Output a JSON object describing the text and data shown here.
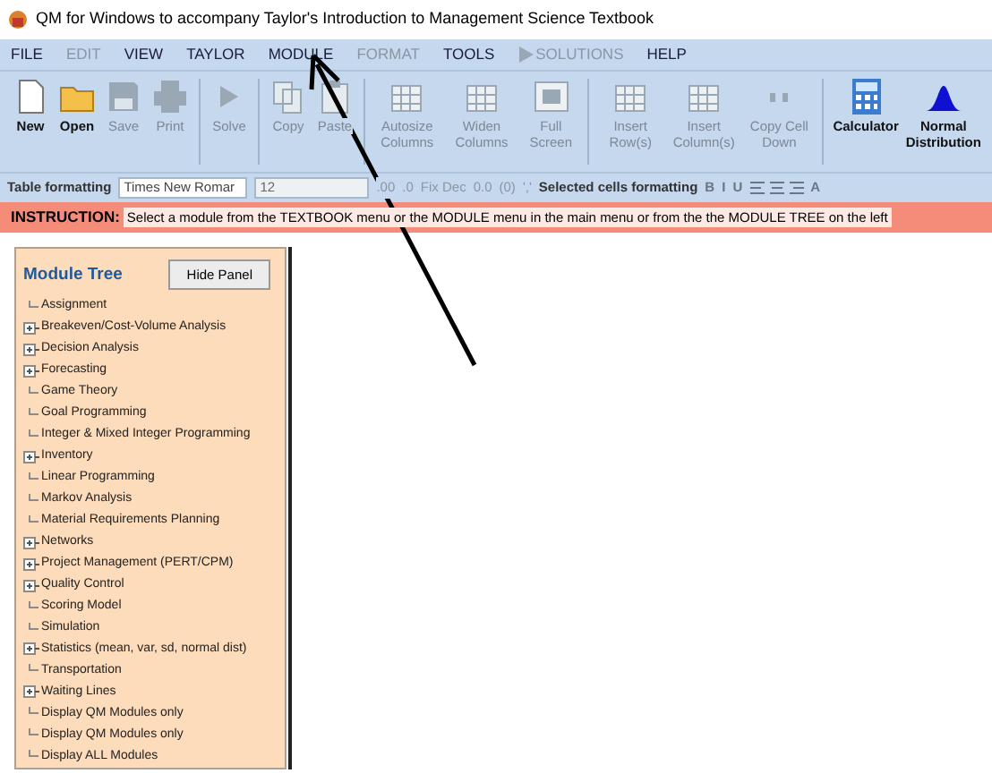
{
  "window": {
    "title": "QM for Windows to accompany Taylor's Introduction to Management Science Textbook"
  },
  "menu": [
    {
      "label": "FILE",
      "disabled": false
    },
    {
      "label": "EDIT",
      "disabled": true
    },
    {
      "label": "VIEW",
      "disabled": false
    },
    {
      "label": "TAYLOR",
      "disabled": false
    },
    {
      "label": "MODULE",
      "disabled": false
    },
    {
      "label": "FORMAT",
      "disabled": true
    },
    {
      "label": "TOOLS",
      "disabled": false
    },
    {
      "label": "SOLUTIONS",
      "disabled": true,
      "kind": "play"
    },
    {
      "label": "HELP",
      "disabled": false
    }
  ],
  "toolbar": [
    {
      "label": "New",
      "kind": "new",
      "disabled": false
    },
    {
      "label": "Open",
      "kind": "open",
      "disabled": false
    },
    {
      "label": "Save",
      "kind": "save",
      "disabled": true
    },
    {
      "label": "Print",
      "kind": "print",
      "disabled": true
    },
    {
      "label": "Solve",
      "kind": "solve",
      "disabled": true,
      "group_start": true
    },
    {
      "label": "Copy",
      "kind": "copy",
      "disabled": true,
      "group_start": true
    },
    {
      "label": "Paste",
      "kind": "paste",
      "disabled": true
    },
    {
      "label": "Autosize Columns",
      "kind": "grid",
      "disabled": true,
      "group_start": true
    },
    {
      "label": "Widen Columns",
      "kind": "grid",
      "disabled": true
    },
    {
      "label": "Full Screen",
      "kind": "screen",
      "disabled": true
    },
    {
      "label": "Insert Row(s)",
      "kind": "grid",
      "disabled": true,
      "group_start": true
    },
    {
      "label": "Insert Column(s)",
      "kind": "grid",
      "disabled": true
    },
    {
      "label": "Copy Cell Down",
      "kind": "quote",
      "disabled": true
    },
    {
      "label": "Calculator",
      "kind": "calculator",
      "disabled": false,
      "group_start": true
    },
    {
      "label": "Normal Distribution",
      "kind": "bell",
      "disabled": false
    }
  ],
  "format_bar": {
    "label": "Table formatting",
    "font": "Times New Romar",
    "size": "12",
    "buttons": [
      ".00",
      ".0",
      "Fix Dec",
      "0.0",
      "(0)",
      "','"
    ],
    "selected_label": "Selected cells formatting",
    "style_buttons": [
      "B",
      "I",
      "U"
    ],
    "color_button": "A"
  },
  "instruction": {
    "label": "INSTRUCTION:",
    "text": "Select a module from the TEXTBOOK menu or the MODULE menu in the main menu or from the the MODULE TREE on the left"
  },
  "module_tree": {
    "title": "Module Tree",
    "hide_button": "Hide Panel",
    "items": [
      {
        "label": "Assignment",
        "expandable": false
      },
      {
        "label": "Breakeven/Cost-Volume Analysis",
        "expandable": true
      },
      {
        "label": "Decision Analysis",
        "expandable": true
      },
      {
        "label": "Forecasting",
        "expandable": true
      },
      {
        "label": "Game Theory",
        "expandable": false
      },
      {
        "label": "Goal Programming",
        "expandable": false
      },
      {
        "label": "Integer & Mixed Integer Programming",
        "expandable": false
      },
      {
        "label": "Inventory",
        "expandable": true
      },
      {
        "label": "Linear Programming",
        "expandable": false
      },
      {
        "label": "Markov Analysis",
        "expandable": false
      },
      {
        "label": "Material Requirements Planning",
        "expandable": false
      },
      {
        "label": "Networks",
        "expandable": true
      },
      {
        "label": "Project Management (PERT/CPM)",
        "expandable": true
      },
      {
        "label": "Quality Control",
        "expandable": true
      },
      {
        "label": "Scoring Model",
        "expandable": false
      },
      {
        "label": "Simulation",
        "expandable": false
      },
      {
        "label": "Statistics (mean, var, sd, normal dist)",
        "expandable": true
      },
      {
        "label": "Transportation",
        "expandable": false
      },
      {
        "label": "Waiting Lines",
        "expandable": true
      },
      {
        "label": "Display QM Modules only",
        "expandable": false
      },
      {
        "label": "Display QM Modules only",
        "expandable": false
      },
      {
        "label": "Display ALL Modules",
        "expandable": false
      }
    ]
  }
}
